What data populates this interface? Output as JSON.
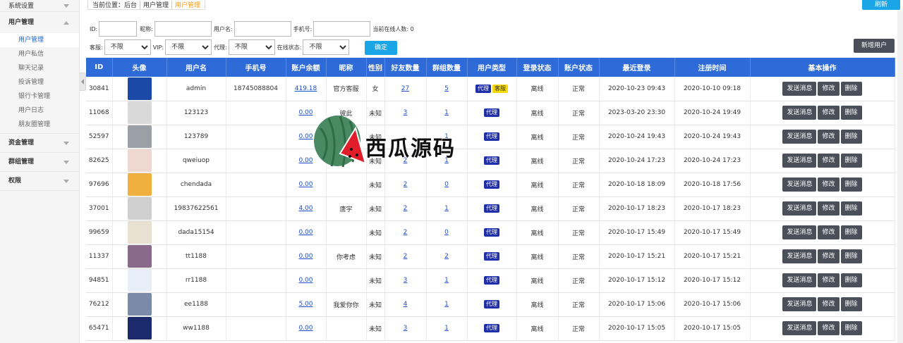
{
  "sidebar": {
    "groups": [
      {
        "label": "系统设置"
      },
      {
        "label": "用户管理"
      },
      {
        "label": "资金管理"
      },
      {
        "label": "群组管理"
      },
      {
        "label": "权限"
      }
    ],
    "user_mgmt_items": [
      "用户管理",
      "用户私信",
      "聊天记录",
      "投诉管理",
      "银行卡管理",
      "用户日志",
      "朋友圈管理"
    ]
  },
  "breadcrumb": {
    "prefix": "当前位置：",
    "home": "后台",
    "parent": "用户管理",
    "current": "用户管理"
  },
  "refresh_label": "刷新",
  "filters": {
    "id_label": "ID:",
    "nick_label": "昵称:",
    "username_label": "用户名:",
    "phone_label": "手机号:",
    "online_count": "当前在线人数: 0",
    "service_label": "客服:",
    "vip_label": "VIP:",
    "agent_label": "代理:",
    "online_status_label": "在线状态:",
    "unlimited": "不限",
    "confirm_label": "确定",
    "add_user_label": "新增用户"
  },
  "table": {
    "columns": [
      "ID",
      "头像",
      "用户名",
      "手机号",
      "账户余额",
      "昵称",
      "性别",
      "好友数量",
      "群组数量",
      "用户类型",
      "登录状态",
      "账户状态",
      "最近登录",
      "注册时间",
      "基本操作"
    ],
    "tag_agent": "代理",
    "tag_service": "客服",
    "op_send": "发送消息",
    "op_edit": "修改",
    "op_delete": "删除",
    "rows": [
      {
        "id": "30841",
        "username": "admin",
        "phone": "18745088804",
        "balance": "419.18",
        "nickname": "官方客服",
        "gender": "女",
        "friends": "27",
        "groups": "5",
        "service": true,
        "login": "离线",
        "status": "正常",
        "last": "2020-10-23 09:43",
        "reg": "2020-10-10 09:18",
        "avatar": "intel"
      },
      {
        "id": "11068",
        "username": "123123",
        "phone": "",
        "balance": "0.00",
        "nickname": "彼此",
        "gender": "未知",
        "friends": "3",
        "groups": "1",
        "service": false,
        "login": "离线",
        "status": "正常",
        "last": "2023-03-20 23:30",
        "reg": "2020-10-24 19:49",
        "avatar": "person"
      },
      {
        "id": "52597",
        "username": "123789",
        "phone": "",
        "balance": "0.00",
        "nickname": "",
        "gender": "未知",
        "friends": "",
        "groups": "1",
        "service": false,
        "login": "离线",
        "status": "正常",
        "last": "2020-10-24 19:43",
        "reg": "2020-10-24 19:43",
        "avatar": "figure"
      },
      {
        "id": "82625",
        "username": "qweiuop",
        "phone": "",
        "balance": "0.00",
        "nickname": "",
        "gender": "未知",
        "friends": "2",
        "groups": "1",
        "service": false,
        "login": "离线",
        "status": "正常",
        "last": "2020-10-24 17:23",
        "reg": "2020-10-24 17:23",
        "avatar": "girl"
      },
      {
        "id": "97696",
        "username": "chendada",
        "phone": "",
        "balance": "0.00",
        "nickname": "",
        "gender": "未知",
        "friends": "2",
        "groups": "0",
        "service": false,
        "login": "离线",
        "status": "正常",
        "last": "2020-10-18 18:09",
        "reg": "2020-10-18 17:56",
        "avatar": "cartoon"
      },
      {
        "id": "37001",
        "username": "19837622561",
        "phone": "",
        "balance": "4.00",
        "nickname": "唐宇",
        "gender": "未知",
        "friends": "2",
        "groups": "1",
        "service": false,
        "login": "离线",
        "status": "正常",
        "last": "2020-10-17 18:23",
        "reg": "2020-10-17 18:23",
        "avatar": "default"
      },
      {
        "id": "99659",
        "username": "dada15154",
        "phone": "",
        "balance": "0.00",
        "nickname": "",
        "gender": "未知",
        "friends": "2",
        "groups": "0",
        "service": false,
        "login": "离线",
        "status": "正常",
        "last": "2020-10-17 15:49",
        "reg": "2020-10-17 15:49",
        "avatar": "cat"
      },
      {
        "id": "11337",
        "username": "tt1188",
        "phone": "",
        "balance": "0.00",
        "nickname": "你考虑",
        "gender": "未知",
        "friends": "2",
        "groups": "2",
        "service": false,
        "login": "离线",
        "status": "正常",
        "last": "2020-10-17 15:21",
        "reg": "2020-10-17 15:21",
        "avatar": "anime"
      },
      {
        "id": "94851",
        "username": "rr1188",
        "phone": "",
        "balance": "0.00",
        "nickname": "",
        "gender": "未知",
        "friends": "3",
        "groups": "1",
        "service": false,
        "login": "离线",
        "status": "正常",
        "last": "2020-10-17 15:12",
        "reg": "2020-10-17 15:12",
        "avatar": "rocket"
      },
      {
        "id": "76212",
        "username": "ee1188",
        "phone": "",
        "balance": "5.00",
        "nickname": "我爱你你",
        "gender": "未知",
        "friends": "4",
        "groups": "1",
        "service": false,
        "login": "离线",
        "status": "正常",
        "last": "2020-10-17 15:06",
        "reg": "2020-10-17 15:06",
        "avatar": "anime2"
      },
      {
        "id": "65471",
        "username": "ww1188",
        "phone": "",
        "balance": "0.00",
        "nickname": "",
        "gender": "未知",
        "friends": "3",
        "groups": "1",
        "service": false,
        "login": "离线",
        "status": "正常",
        "last": "2020-10-17 15:05",
        "reg": "2020-10-17 15:05",
        "avatar": "conan"
      }
    ]
  },
  "watermark": {
    "text": "西瓜源码"
  },
  "colors": {
    "primary": "#2f6bd8",
    "accent": "#1aa5e6",
    "dark_button": "#4a4f5a",
    "link": "#1e4fc9",
    "tag_agent": "#1f2fa8",
    "tag_service": "#f5d90a"
  }
}
